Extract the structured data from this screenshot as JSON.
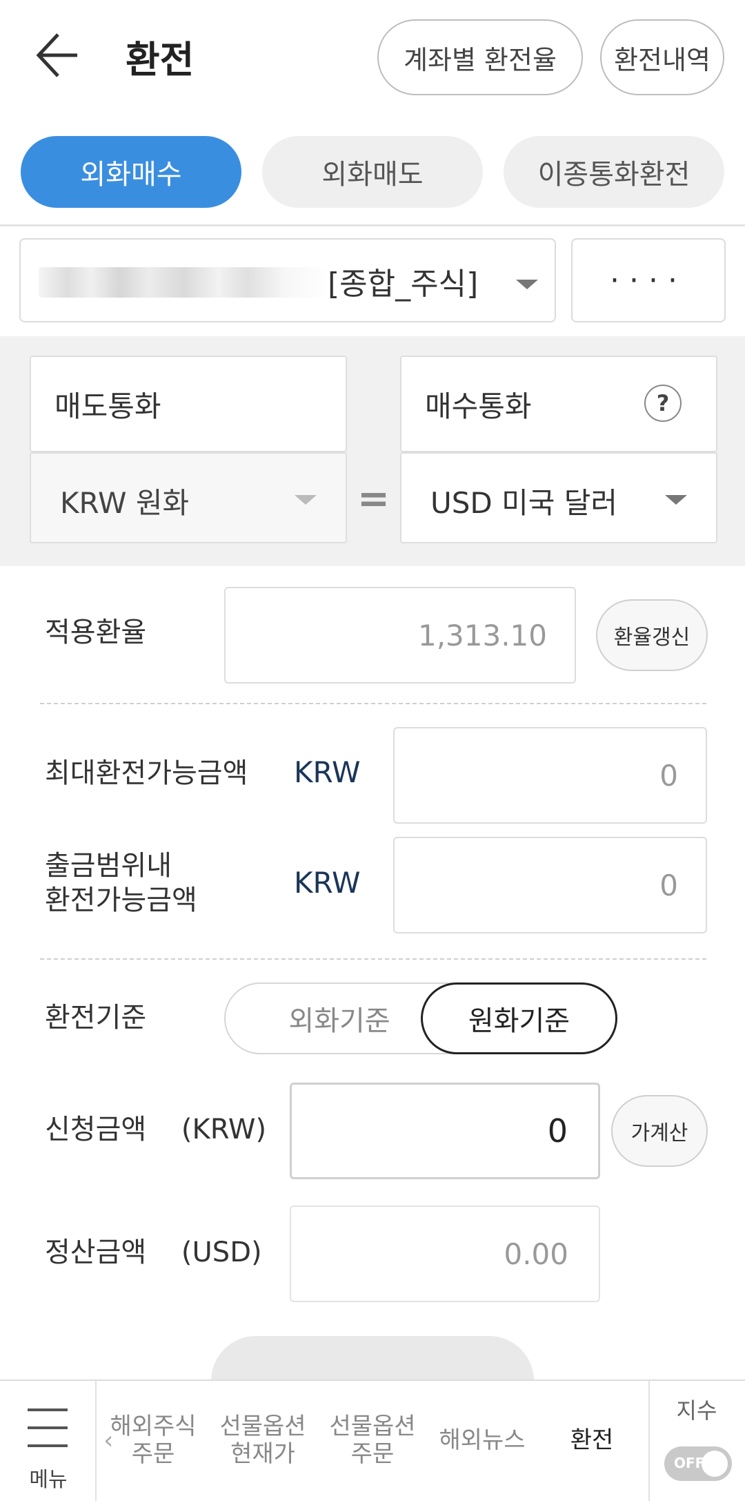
{
  "header": {
    "title": "환전",
    "rate_by_account_label": "계좌별 환전율",
    "history_label": "환전내역"
  },
  "tabs": [
    {
      "label": "외화매수",
      "active": true
    },
    {
      "label": "외화매도",
      "active": false
    },
    {
      "label": "이종통화환전",
      "active": false
    }
  ],
  "account": {
    "type_label": "[종합_주식]",
    "password_mask": "····"
  },
  "currency": {
    "sell_label": "매도통화",
    "buy_label": "매수통화",
    "help_label": "?",
    "sell_value": "KRW 원화",
    "buy_value": "USD 미국 달러",
    "equals": "="
  },
  "rate": {
    "label": "적용환율",
    "value": "1,313.10",
    "refresh_label": "환율갱신"
  },
  "max_amount": {
    "label": "최대환전가능금액",
    "currency": "KRW",
    "value": "0"
  },
  "withdraw_amount": {
    "label_line1": "출금범위내",
    "label_line2": "환전가능금액",
    "currency": "KRW",
    "value": "0"
  },
  "basis": {
    "label": "환전기준",
    "option_foreign": "외화기준",
    "option_krw": "원화기준",
    "selected": "원화기준"
  },
  "request": {
    "label": "신청금액",
    "currency_label": "(KRW)",
    "value": "0",
    "calc_label": "가계산"
  },
  "settlement": {
    "label": "정산금액",
    "currency_label": "(USD)",
    "value": "0.00"
  },
  "bottom_nav": {
    "menu_label": "메뉴",
    "left_arrow": "‹",
    "items": [
      {
        "line1": "해외주식",
        "line2": "주문"
      },
      {
        "line1": "선물옵션",
        "line2": "현재가"
      },
      {
        "line1": "선물옵션",
        "line2": "주문"
      },
      {
        "line1": "해외뉴스",
        "line2": ""
      },
      {
        "line1": "환전",
        "line2": ""
      }
    ],
    "index_label": "지수",
    "toggle_label": "OFF"
  },
  "colors": {
    "accent": "#3a8ee0",
    "currency_text": "#1a3558"
  }
}
